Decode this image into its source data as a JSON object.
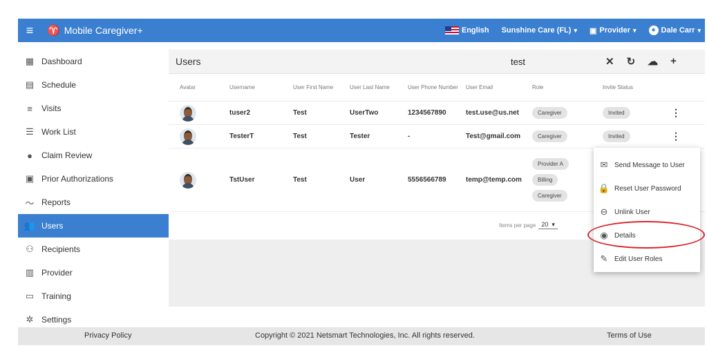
{
  "topbar": {
    "app_name": "Mobile Caregiver+",
    "language": "English",
    "agency": "Sunshine Care (FL)",
    "role": "Provider",
    "user": "Dale Carr"
  },
  "sidebar": {
    "items": [
      {
        "label": "Dashboard",
        "icon": "dashboard-icon"
      },
      {
        "label": "Schedule",
        "icon": "calendar-icon"
      },
      {
        "label": "Visits",
        "icon": "filter-icon"
      },
      {
        "label": "Work List",
        "icon": "list-icon"
      },
      {
        "label": "Claim Review",
        "icon": "alert-icon"
      },
      {
        "label": "Prior Authorizations",
        "icon": "calendar-day-icon"
      },
      {
        "label": "Reports",
        "icon": "trend-icon"
      },
      {
        "label": "Users",
        "icon": "people-icon"
      },
      {
        "label": "Recipients",
        "icon": "people-outline-icon"
      },
      {
        "label": "Provider",
        "icon": "clipboard-icon"
      },
      {
        "label": "Training",
        "icon": "training-icon"
      },
      {
        "label": "Settings",
        "icon": "gear-icon"
      }
    ],
    "active_index": 7
  },
  "panel": {
    "title": "Users",
    "search_value": "test"
  },
  "table": {
    "headers": [
      "Avatar",
      "Username",
      "User First Name",
      "User Last Name",
      "User Phone Number",
      "User Email",
      "Role",
      "Invite Status"
    ],
    "rows": [
      {
        "username": "tuser2",
        "first": "Test",
        "last": "UserTwo",
        "phone": "1234567890",
        "email": "test.use@us.net",
        "roles": [
          "Caregiver"
        ],
        "invite": "Invited"
      },
      {
        "username": "TesterT",
        "first": "Test",
        "last": "Tester",
        "phone": "-",
        "email": "Test@gmail.com",
        "roles": [
          "Caregiver"
        ],
        "invite": "Invited"
      },
      {
        "username": "TstUser",
        "first": "Test",
        "last": "User",
        "phone": "5556566789",
        "email": "temp@temp.com",
        "roles": [
          "Provider A",
          "Billing",
          "Caregiver"
        ],
        "invite": ""
      }
    ]
  },
  "pager": {
    "label": "Items per page",
    "value": "20"
  },
  "menu": {
    "items": [
      {
        "label": "Send Message to User",
        "icon": "mail-icon"
      },
      {
        "label": "Reset User Password",
        "icon": "lock-icon"
      },
      {
        "label": "Unlink User",
        "icon": "unlink-icon"
      },
      {
        "label": "Details",
        "icon": "eye-icon"
      },
      {
        "label": "Edit User Roles",
        "icon": "pencil-icon"
      }
    ]
  },
  "footer": {
    "privacy": "Privacy Policy",
    "copyright": "Copyright © 2021 Netsmart Technologies, Inc. All rights reserved.",
    "terms": "Terms of Use"
  },
  "colors": {
    "primary": "#3b7fd1",
    "highlight_ring": "#d8242a"
  }
}
